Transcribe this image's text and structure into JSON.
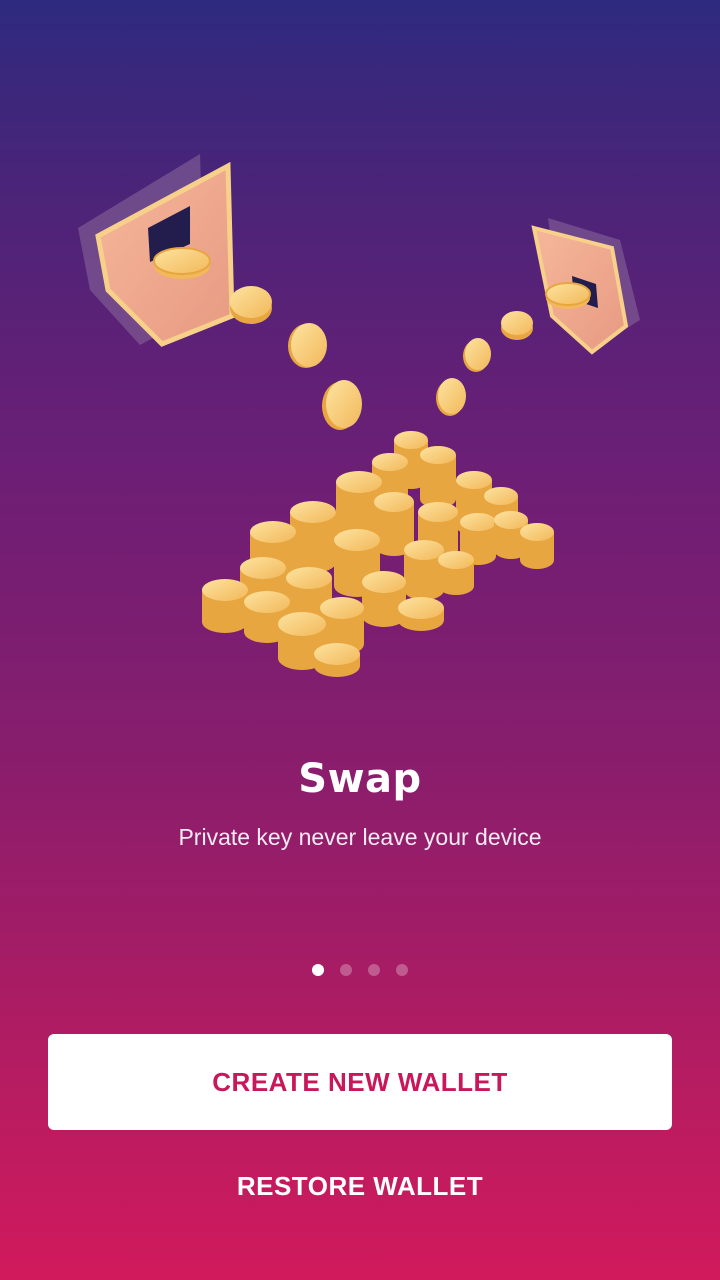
{
  "slide": {
    "title": "Swap",
    "subtitle": "Private key never leave your device",
    "illustration": "shields-and-coins-illustration"
  },
  "pager": {
    "count": 4,
    "active_index": 0
  },
  "actions": {
    "create_label": "CREATE NEW WALLET",
    "restore_label": "RESTORE WALLET"
  },
  "colors": {
    "gradient_top": "#2e2a7f",
    "gradient_bottom": "#d11a5c",
    "accent": "#c8175a",
    "coin": "#f7c873"
  }
}
